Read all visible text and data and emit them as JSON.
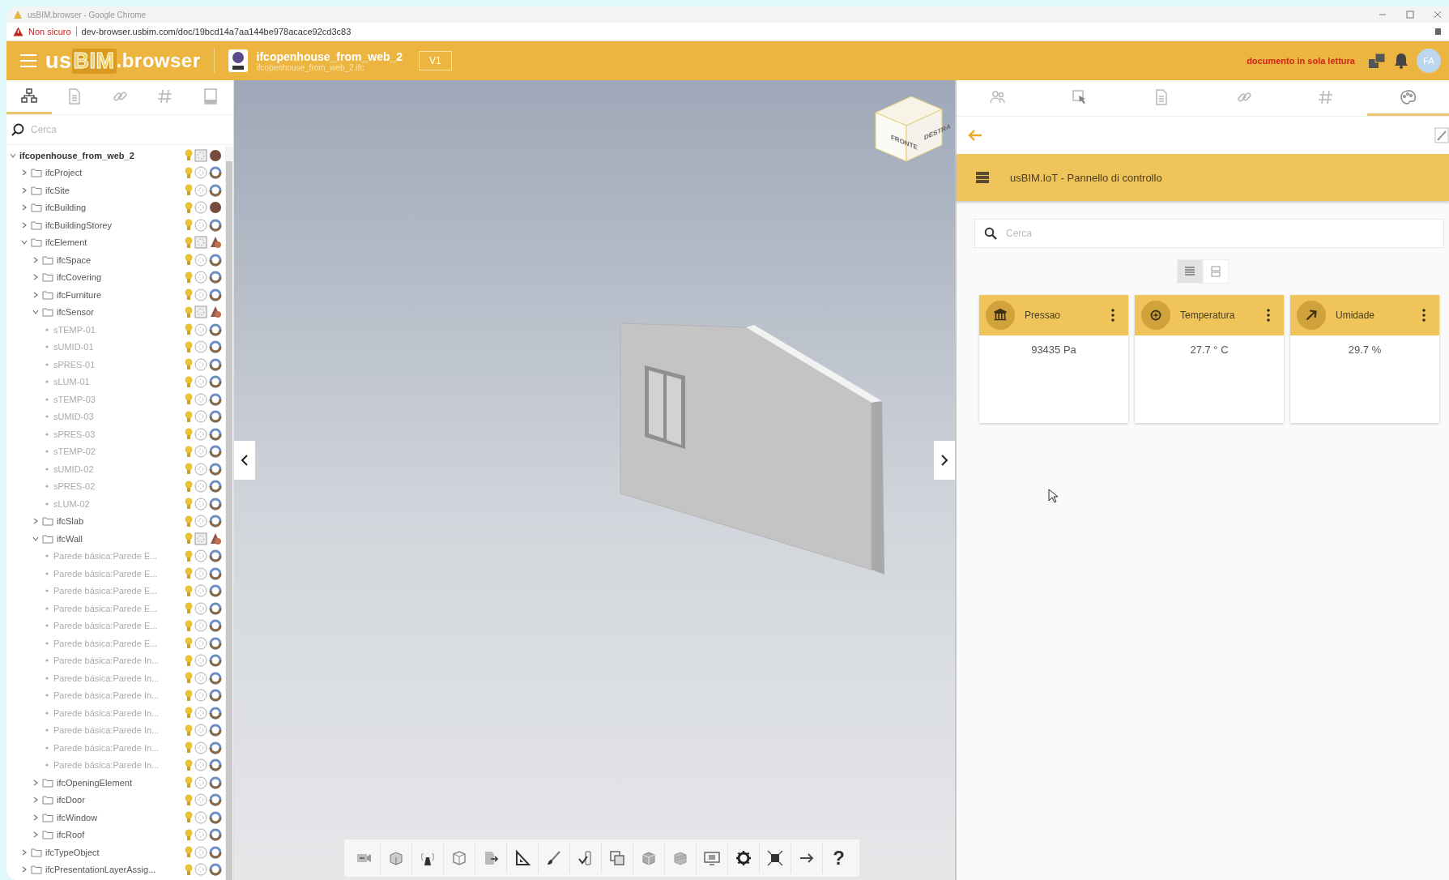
{
  "browser": {
    "title": "usBIM.browser - Google Chrome",
    "security": "Non sicuro",
    "url": "dev-browser.usbim.com/doc/19bcd14a7aa144be978acace92cd3c83"
  },
  "header": {
    "logo": {
      "prefix": "us",
      "highlight": "BIM",
      "suffix": ".browser"
    },
    "document": {
      "name": "ifcopenhouse_from_web_2",
      "file": "ifcopenhouse_from_web_2.ifc",
      "version": "V1"
    },
    "notice": "documento in sola lettura",
    "avatar": "FA"
  },
  "left_panel": {
    "tabs": [
      {
        "selected": true
      },
      {
        "selected": false
      },
      {
        "selected": false
      },
      {
        "selected": false
      },
      {
        "selected": false
      }
    ],
    "search": {
      "placeholder": "Cerca"
    },
    "tree": [
      {
        "label": "ifcopenhouse_from_web_2",
        "kind": "root",
        "mixed": true,
        "filled": true,
        "expanded": true,
        "children": [
          {
            "label": "ifcProject",
            "kind": "folder",
            "mixed": false,
            "filled": false,
            "expanded": false
          },
          {
            "label": "ifcSite",
            "kind": "folder",
            "mixed": false,
            "filled": false,
            "expanded": false
          },
          {
            "label": "ifcBuilding",
            "kind": "folder",
            "mixed": false,
            "filled": true,
            "expanded": false
          },
          {
            "label": "ifcBuildingStorey",
            "kind": "folder",
            "mixed": false,
            "filled": false,
            "expanded": false
          },
          {
            "label": "ifcElement",
            "kind": "folder",
            "mixed": true,
            "filled": false,
            "expanded": true,
            "children": [
              {
                "label": "ifcSpace",
                "kind": "folder",
                "mixed": false,
                "filled": false,
                "expanded": false
              },
              {
                "label": "ifcCovering",
                "kind": "folder",
                "mixed": false,
                "filled": false,
                "expanded": false
              },
              {
                "label": "ifcFurniture",
                "kind": "folder",
                "mixed": false,
                "filled": false,
                "expanded": false
              },
              {
                "label": "ifcSensor",
                "kind": "folder",
                "mixed": true,
                "filled": false,
                "expanded": true,
                "children": [
                  {
                    "label": "sTEMP-01",
                    "kind": "item",
                    "mixed": false,
                    "filled": false
                  },
                  {
                    "label": "sUMID-01",
                    "kind": "item",
                    "mixed": false,
                    "filled": false
                  },
                  {
                    "label": "sPRES-01",
                    "kind": "item",
                    "mixed": false,
                    "filled": false
                  },
                  {
                    "label": "sLUM-01",
                    "kind": "item",
                    "mixed": false,
                    "filled": false
                  },
                  {
                    "label": "sTEMP-03",
                    "kind": "item",
                    "mixed": false,
                    "filled": false
                  },
                  {
                    "label": "sUMID-03",
                    "kind": "item",
                    "mixed": false,
                    "filled": false
                  },
                  {
                    "label": "sPRES-03",
                    "kind": "item",
                    "mixed": false,
                    "filled": false
                  },
                  {
                    "label": "sTEMP-02",
                    "kind": "item",
                    "mixed": false,
                    "filled": false
                  },
                  {
                    "label": "sUMID-02",
                    "kind": "item",
                    "mixed": false,
                    "filled": false
                  },
                  {
                    "label": "sPRES-02",
                    "kind": "item",
                    "mixed": false,
                    "filled": false
                  },
                  {
                    "label": "sLUM-02",
                    "kind": "item",
                    "mixed": false,
                    "filled": false
                  }
                ]
              },
              {
                "label": "ifcSlab",
                "kind": "folder",
                "mixed": false,
                "filled": false,
                "expanded": false
              },
              {
                "label": "ifcWall",
                "kind": "folder",
                "mixed": true,
                "filled": false,
                "expanded": true,
                "children": [
                  {
                    "label": "Parede básica:Parede E...",
                    "kind": "item",
                    "mixed": false,
                    "filled": false
                  },
                  {
                    "label": "Parede básica:Parede E...",
                    "kind": "item",
                    "mixed": false,
                    "filled": false
                  },
                  {
                    "label": "Parede básica:Parede E...",
                    "kind": "item",
                    "mixed": false,
                    "filled": false
                  },
                  {
                    "label": "Parede básica:Parede E...",
                    "kind": "item",
                    "mixed": false,
                    "filled": false
                  },
                  {
                    "label": "Parede básica:Parede E...",
                    "kind": "item",
                    "mixed": false,
                    "filled": false
                  },
                  {
                    "label": "Parede básica:Parede E...",
                    "kind": "item",
                    "mixed": false,
                    "filled": false
                  },
                  {
                    "label": "Parede básica:Parede In...",
                    "kind": "item",
                    "mixed": false,
                    "filled": false
                  },
                  {
                    "label": "Parede básica:Parede In...",
                    "kind": "item",
                    "mixed": false,
                    "filled": false
                  },
                  {
                    "label": "Parede básica:Parede In...",
                    "kind": "item",
                    "mixed": false,
                    "filled": false
                  },
                  {
                    "label": "Parede básica:Parede In...",
                    "kind": "item",
                    "mixed": false,
                    "filled": false
                  },
                  {
                    "label": "Parede básica:Parede In...",
                    "kind": "item",
                    "mixed": false,
                    "filled": false
                  },
                  {
                    "label": "Parede básica:Parede In...",
                    "kind": "item",
                    "mixed": false,
                    "filled": false
                  },
                  {
                    "label": "Parede básica:Parede In...",
                    "kind": "item",
                    "mixed": false,
                    "filled": false
                  }
                ]
              },
              {
                "label": "ifcOpeningElement",
                "kind": "folder",
                "mixed": false,
                "filled": false,
                "expanded": false
              },
              {
                "label": "ifcDoor",
                "kind": "folder",
                "mixed": false,
                "filled": false,
                "expanded": false
              },
              {
                "label": "ifcWindow",
                "kind": "folder",
                "mixed": false,
                "filled": false,
                "expanded": false
              },
              {
                "label": "ifcRoof",
                "kind": "folder",
                "mixed": false,
                "filled": false,
                "expanded": false
              }
            ]
          },
          {
            "label": "ifcTypeObject",
            "kind": "folder",
            "mixed": false,
            "filled": false,
            "expanded": false
          },
          {
            "label": "ifcPresentationLayerAssig...",
            "kind": "folder",
            "mixed": false,
            "filled": false,
            "expanded": false
          }
        ]
      }
    ]
  },
  "viewer": {
    "cube": {
      "front": "FRONTE",
      "right": "DESTRA"
    },
    "toolbar": {
      "help": "?"
    }
  },
  "right_panel": {
    "tabs": [
      {
        "selected": false
      },
      {
        "selected": false
      },
      {
        "selected": false
      },
      {
        "selected": false
      },
      {
        "selected": false
      },
      {
        "selected": true
      }
    ],
    "title": "usBIM.IoT - Pannello di controllo",
    "search": {
      "placeholder": "Cerca"
    },
    "views": [
      {
        "selected": true
      },
      {
        "selected": false
      }
    ],
    "cards": [
      {
        "title": "Pressao",
        "value": "93435 Pa"
      },
      {
        "title": "Temperatura",
        "value": "27.7 ° C"
      },
      {
        "title": "Umidade",
        "value": "29.7 %"
      }
    ]
  }
}
